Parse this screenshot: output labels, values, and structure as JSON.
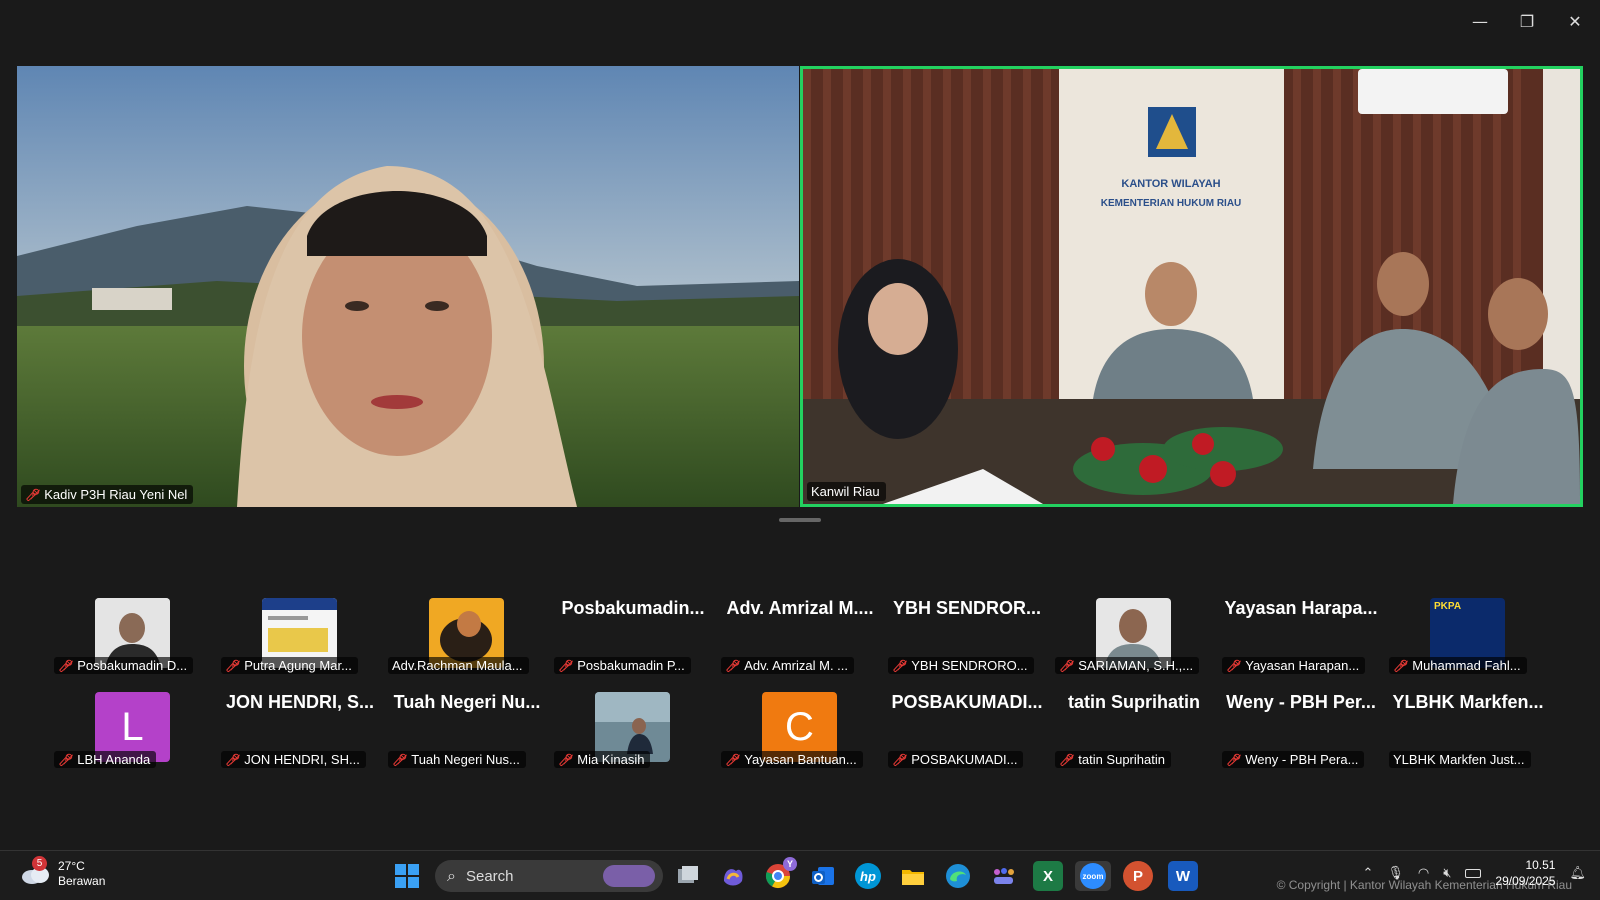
{
  "window": {
    "minimize": "—",
    "restore": "❐",
    "close": "✕"
  },
  "speakers": {
    "left": {
      "name": "Kadiv P3H Riau Yeni Nel"
    },
    "right": {
      "name": "Kanwil Riau",
      "sign_line1": "KANTOR WILAYAH",
      "sign_line2": "KEMENTERIAN HUKUM RIAU"
    }
  },
  "gallery": [
    {
      "tag": "Posbakumadin D...",
      "big": "",
      "pic": "photo-man",
      "muted": true
    },
    {
      "tag": "Putra Agung Mar...",
      "big": "",
      "pic": "document",
      "muted": true
    },
    {
      "tag": "Adv.Rachman Maula...",
      "big": "",
      "pic": "art",
      "muted": false
    },
    {
      "tag": "Posbakumadin P...",
      "big": "Posbakumadin...",
      "pic": "",
      "muted": true
    },
    {
      "tag": "Adv. Amrizal M. ...",
      "big": "Adv. Amrizal M....",
      "pic": "",
      "muted": true
    },
    {
      "tag": "YBH SENDRORO...",
      "big": "YBH SENDROR...",
      "pic": "",
      "muted": true
    },
    {
      "tag": "SARIAMAN, S.H.,...",
      "big": "",
      "pic": "photo-officer",
      "muted": true
    },
    {
      "tag": "Yayasan Harapan...",
      "big": "Yayasan Harapa...",
      "pic": "",
      "muted": true
    },
    {
      "tag": "Muhammad Fahl...",
      "big": "",
      "pic": "pkpa",
      "muted": true
    },
    {
      "tag": "LBH Ananda",
      "big": "",
      "pic": "letter-L",
      "muted": true
    },
    {
      "tag": "JON HENDRI, SH...",
      "big": "JON HENDRI, S...",
      "pic": "",
      "muted": true
    },
    {
      "tag": "Tuah Negeri Nus...",
      "big": "Tuah Negeri Nu...",
      "pic": "",
      "muted": true
    },
    {
      "tag": "Mia Kinasih",
      "big": "",
      "pic": "photo-room",
      "muted": true
    },
    {
      "tag": "Yayasan Bantuan...",
      "big": "",
      "pic": "letter-C",
      "muted": true
    },
    {
      "tag": "POSBAKUMADI...",
      "big": "POSBAKUMADI...",
      "pic": "",
      "muted": true
    },
    {
      "tag": "tatin Suprihatin",
      "big": "tatin Suprihatin",
      "pic": "",
      "muted": true
    },
    {
      "tag": "Weny - PBH Pera...",
      "big": "Weny - PBH Per...",
      "pic": "",
      "muted": true
    },
    {
      "tag": "YLBHK Markfen Just...",
      "big": "YLBHK Markfen...",
      "pic": "",
      "muted": false
    }
  ],
  "avatars": {
    "L": "L",
    "C": "C",
    "pkpa": "PKPA"
  },
  "taskbar": {
    "weather_temp": "27°C",
    "weather_desc": "Berawan",
    "weather_badge": "5",
    "search_placeholder": "Search",
    "time": "10.51",
    "date": "29/09/2025",
    "apps": [
      "start",
      "task-view",
      "copilot",
      "chrome",
      "outlook",
      "hp",
      "explorer",
      "edge",
      "teams",
      "excel",
      "zoom",
      "powerpoint",
      "word"
    ],
    "chrome_badge": "Y",
    "excel_label": "X",
    "ppt_label": "P",
    "word_label": "W",
    "hp_label": "hp",
    "zoom_label": "zoom"
  },
  "watermark": "© Copyright | Kantor Wilayah Kementerian Hukum Riau"
}
